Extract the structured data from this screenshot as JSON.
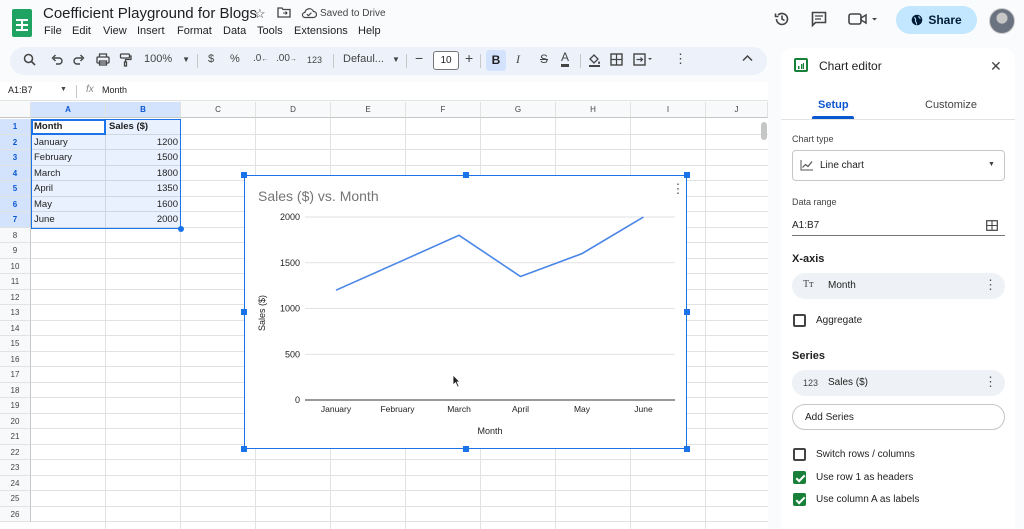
{
  "app": {
    "doc_title": "Coefficient Playground for Blogs",
    "saved_status": "Saved to Drive",
    "menus": [
      "File",
      "Edit",
      "View",
      "Insert",
      "Format",
      "Data",
      "Tools",
      "Extensions",
      "Help"
    ],
    "share_label": "Share"
  },
  "toolbar": {
    "zoom": "100%",
    "currency": "$",
    "percent": "%",
    "decimal_decrease": ".0",
    "decimal_increase": ".00",
    "number_format": "123",
    "font": "Defaul...",
    "font_size": "10",
    "bold": "B",
    "italic": "I",
    "strike": "S",
    "text_color": "A"
  },
  "formula_bar": {
    "name_box": "A1:B7",
    "fx": "fx",
    "value": "Month"
  },
  "grid": {
    "columns": [
      "A",
      "B",
      "C",
      "D",
      "E",
      "F",
      "G",
      "H",
      "I",
      "J"
    ],
    "rows": [
      "1",
      "2",
      "3",
      "4",
      "5",
      "6",
      "7",
      "8",
      "9",
      "10",
      "11",
      "12",
      "13",
      "14",
      "15",
      "16",
      "17",
      "18",
      "19",
      "20",
      "21",
      "22",
      "23",
      "24",
      "25",
      "26"
    ],
    "cells": [
      [
        "Month",
        "Sales ($)"
      ],
      [
        "January",
        "1200"
      ],
      [
        "February",
        "1500"
      ],
      [
        "March",
        "1800"
      ],
      [
        "April",
        "1350"
      ],
      [
        "May",
        "1600"
      ],
      [
        "June",
        "2000"
      ]
    ]
  },
  "chart_data": {
    "type": "line",
    "title": "Sales ($) vs. Month",
    "xlabel": "Month",
    "ylabel": "Sales ($)",
    "categories": [
      "January",
      "February",
      "March",
      "April",
      "May",
      "June"
    ],
    "series": [
      {
        "name": "Sales ($)",
        "values": [
          1200,
          1500,
          1800,
          1350,
          1600,
          2000
        ]
      }
    ],
    "ylim": [
      0,
      2000
    ],
    "yticks": [
      "0",
      "500",
      "1000",
      "1500",
      "2000"
    ],
    "line_color": "#4a86e8",
    "grid": true,
    "legend": "none"
  },
  "editor": {
    "title": "Chart editor",
    "tabs": [
      "Setup",
      "Customize"
    ],
    "chart_type_label": "Chart type",
    "chart_type_value": "Line chart",
    "data_range_label": "Data range",
    "data_range_value": "A1:B7",
    "xaxis_label": "X-axis",
    "xaxis_value": "Month",
    "xaxis_icon": "Tт",
    "aggregate_label": "Aggregate",
    "series_label": "Series",
    "series_value": "Sales ($)",
    "series_icon": "123",
    "add_series": "Add Series",
    "switch_rows": "Switch rows / columns",
    "use_row1": "Use row 1 as headers",
    "use_colA": "Use column A as labels",
    "accent_color": "#188038"
  }
}
